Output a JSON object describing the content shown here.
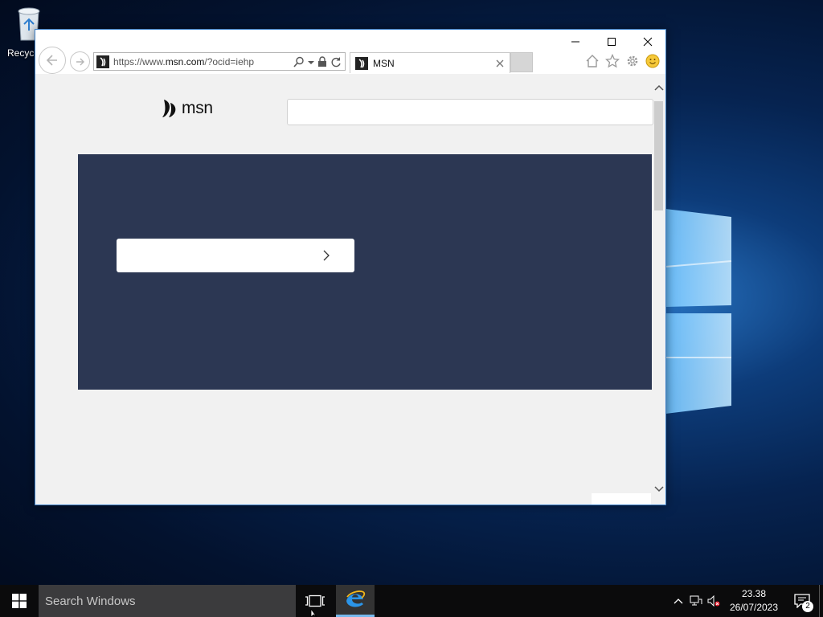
{
  "desktop": {
    "recycle_bin_label": "Recycl"
  },
  "browser": {
    "address_url_prefix": "https://www.",
    "address_url_domain": "msn.com",
    "address_url_suffix": "/?ocid=iehp",
    "tab_title": "MSN"
  },
  "page": {
    "logo_text": "msn",
    "search_placeholder": ""
  },
  "taskbar": {
    "search_placeholder": "Search Windows",
    "clock_time": "23.38",
    "clock_date": "26/07/2023",
    "notification_count": "2"
  },
  "colors": {
    "hero_bg": "#2c3753",
    "window_border": "#3c7fc7",
    "taskbar_bg": "#0b0b0c"
  }
}
